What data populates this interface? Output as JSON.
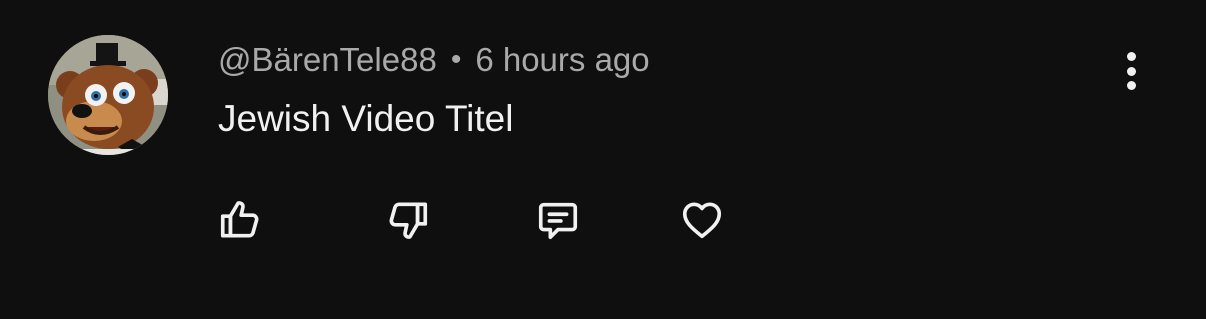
{
  "comment": {
    "author": "@BärenTele88",
    "separator": "•",
    "time": "6 hours ago",
    "text": "Jewish Video Titel"
  },
  "icons": {
    "avatar": "cartoon-bear-avatar",
    "more": "more-vertical-icon",
    "like": "thumbs-up-icon",
    "dislike": "thumbs-down-icon",
    "reply": "comment-reply-icon",
    "heart": "heart-icon"
  },
  "colors": {
    "background": "#0f0f0f",
    "author_text": "#a9a9a9",
    "comment_text": "#f1f1f1",
    "icon": "#f1f1f1"
  }
}
